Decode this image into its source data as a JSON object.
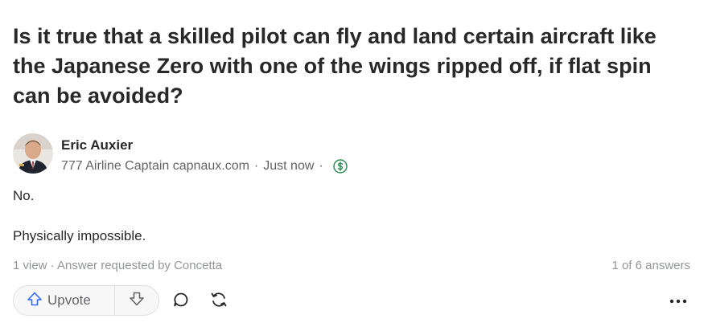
{
  "question": {
    "title": "Is it true that a skilled pilot can fly and land certain aircraft like the Japanese Zero with one of the wings ripped off, if flat spin can be avoided?"
  },
  "author": {
    "name": "Eric Auxier",
    "credential": "777 Airline Captain capnaux.com",
    "separator": "·",
    "timestamp": "Just now",
    "badge_icon": "dollar-circle-icon"
  },
  "answer": {
    "paragraphs": [
      "No.",
      "Physically impossible."
    ]
  },
  "footer": {
    "views_meta": "1 view · Answer requested by Concetta",
    "answer_count": "1 of 6 answers"
  },
  "actions": {
    "upvote_label": "Upvote",
    "icons": [
      "arrow-up-icon",
      "arrow-down-icon",
      "comment-icon",
      "share-icon",
      "more-icon"
    ]
  },
  "colors": {
    "text": "#282829",
    "secondary": "#636466",
    "muted": "#939598",
    "upvote_blue": "#2e69ff",
    "money_green": "#2e8d54"
  }
}
